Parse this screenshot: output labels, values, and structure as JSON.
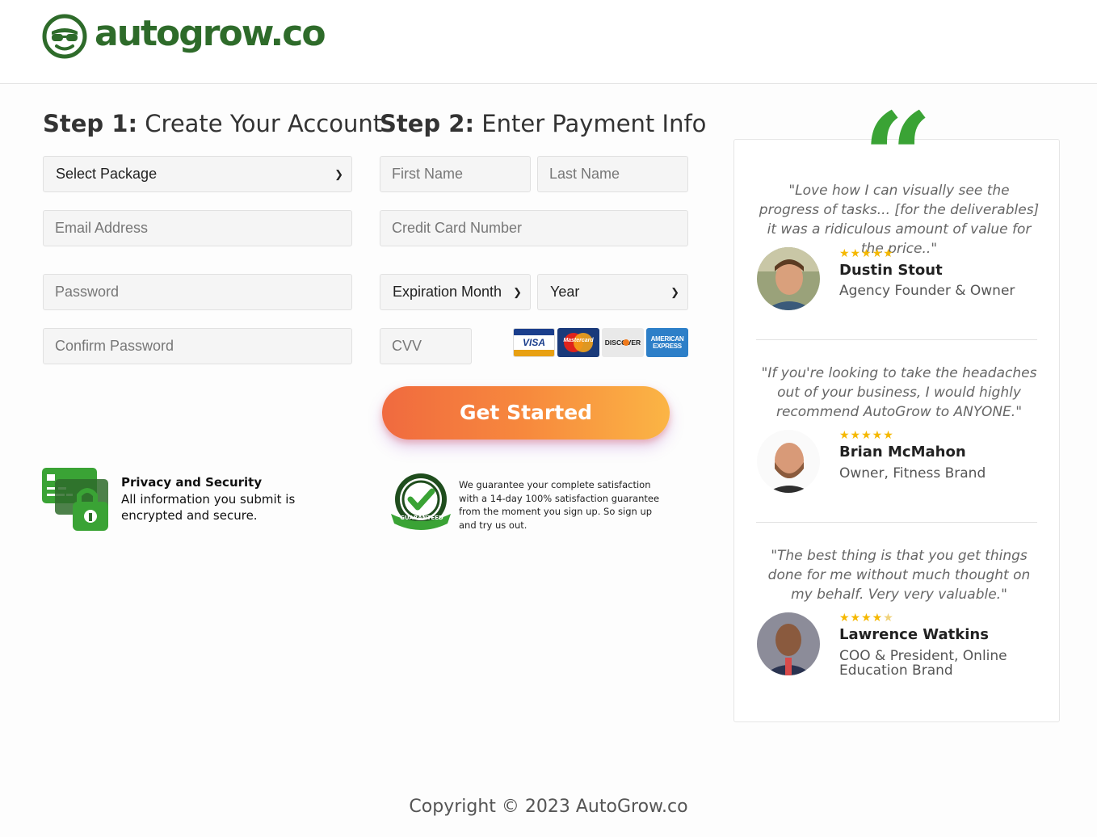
{
  "brand": {
    "name": "autogrow.co",
    "color": "#2e6b2a",
    "accent": "#3aa335"
  },
  "step1": {
    "label": "Step 1:",
    "title": "Create Your Account"
  },
  "step2": {
    "label": "Step 2:",
    "title": "Enter Payment Info"
  },
  "account": {
    "package_select": "Select Package",
    "email_placeholder": "Email Address",
    "password_placeholder": "Password",
    "confirm_password_placeholder": "Confirm Password"
  },
  "payment": {
    "first_name_placeholder": "First Name",
    "last_name_placeholder": "Last Name",
    "card_number_placeholder": "Credit Card Number",
    "exp_month_select": "Expiration Month",
    "exp_year_select": "Year",
    "cvv_placeholder": "CVV",
    "cards": [
      "VISA",
      "Mastercard",
      "DISCOVER",
      "AMERICAN EXPRESS"
    ]
  },
  "cta": {
    "label": "Get Started"
  },
  "privacy": {
    "title": "Privacy and Security",
    "text": "All information you submit is encrypted and secure."
  },
  "guarantee": {
    "badge": "GUARANTEED",
    "text": "We guarantee your complete satisfaction with a 14-day 100% satisfaction guarantee from the moment you sign up. So sign up and try us out."
  },
  "testimonials": [
    {
      "quote": "\"Love how I can visually see the progress of tasks... [for the deliverables] it was a ridiculous amount of value for the price..\"",
      "rating": 5,
      "name": "Dustin Stout",
      "role": "Agency Founder & Owner"
    },
    {
      "quote": "\"If you're looking to take the headaches out of your business, I would highly recommend AutoGrow to ANYONE.\"",
      "rating": 5,
      "name": "Brian McMahon",
      "role": "Owner, Fitness Brand"
    },
    {
      "quote": "\"The best thing is that you get things done for me without much thought on my behalf. Very very valuable.\"",
      "rating": 4.5,
      "name": "Lawrence Watkins",
      "role": "COO & President, Online Education Brand"
    }
  ],
  "footer": {
    "copyright": "Copyright © 2023 AutoGrow.co"
  }
}
